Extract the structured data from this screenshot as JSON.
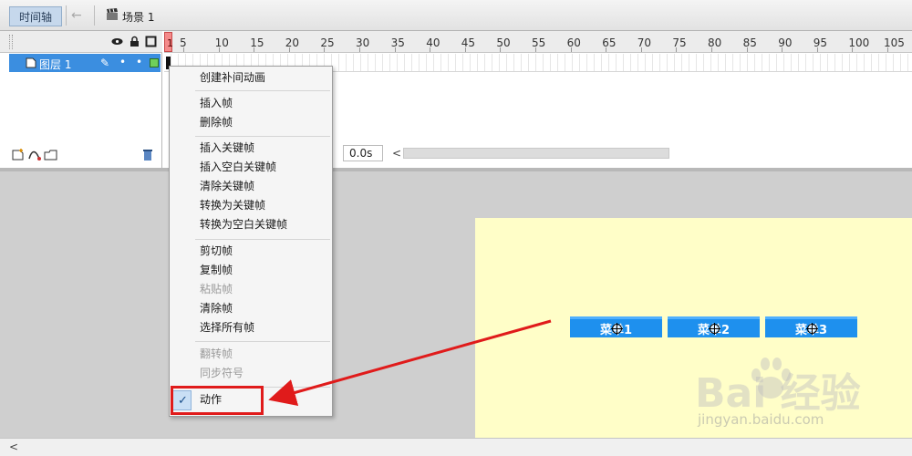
{
  "toolbar": {
    "tab_label": "时间轴",
    "scene_label": "场景 1"
  },
  "timeline": {
    "layer_name": "图层 1",
    "playhead_frame": "1",
    "ruler_ticks": [
      "5",
      "10",
      "15",
      "20",
      "25",
      "30",
      "35",
      "40",
      "45",
      "50",
      "55",
      "60",
      "65",
      "70",
      "75",
      "80",
      "85",
      "90",
      "95",
      "100",
      "105"
    ],
    "time_display": "0.0s"
  },
  "stage": {
    "buttons": [
      {
        "label": "菜单1"
      },
      {
        "label": "菜单2"
      },
      {
        "label": "菜单3"
      }
    ]
  },
  "context_menu": {
    "items": [
      {
        "label": "创建补间动画",
        "enabled": true
      },
      {
        "label": "插入帧",
        "enabled": true
      },
      {
        "label": "删除帧",
        "enabled": true
      },
      {
        "label": "插入关键帧",
        "enabled": true
      },
      {
        "label": "插入空白关键帧",
        "enabled": true
      },
      {
        "label": "清除关键帧",
        "enabled": true
      },
      {
        "label": "转换为关键帧",
        "enabled": true
      },
      {
        "label": "转换为空白关键帧",
        "enabled": true
      },
      {
        "label": "剪切帧",
        "enabled": true
      },
      {
        "label": "复制帧",
        "enabled": true
      },
      {
        "label": "粘贴帧",
        "enabled": false
      },
      {
        "label": "清除帧",
        "enabled": true
      },
      {
        "label": "选择所有帧",
        "enabled": true
      },
      {
        "label": "翻转帧",
        "enabled": false
      },
      {
        "label": "同步符号",
        "enabled": false
      },
      {
        "label": "动作",
        "enabled": true,
        "checked": true
      }
    ]
  },
  "watermark": {
    "brand": "Bai 经验",
    "url": "jingyan.baidu.com"
  },
  "colors": {
    "selected_layer": "#3b8ee0",
    "stage_bg": "#fffec8",
    "menu_button": "#1e90ee",
    "annotation": "#e01b1b"
  }
}
